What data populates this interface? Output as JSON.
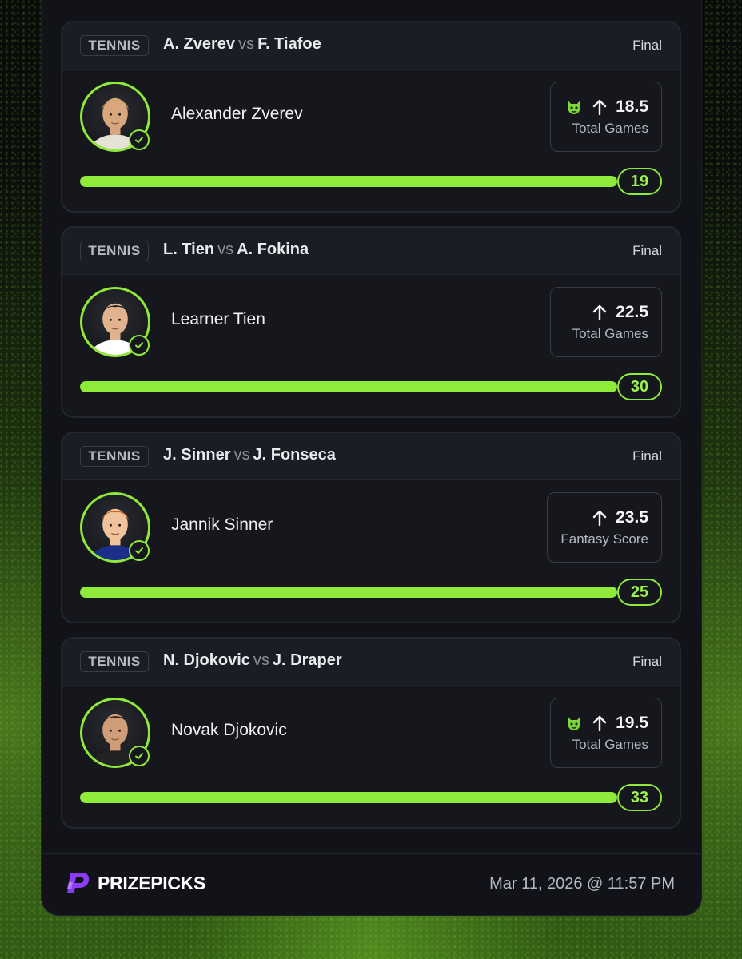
{
  "cards": [
    {
      "sport": "TENNIS",
      "player1": "A. Zverev",
      "vs": "vs",
      "player2": "F. Tiafoe",
      "status": "Final",
      "player_name": "Alexander Zverev",
      "has_demon_icon": true,
      "direction_icon": "arrow-up-icon",
      "line": "18.5",
      "stat": "Total Games",
      "result": "19",
      "progress": 1.0
    },
    {
      "sport": "TENNIS",
      "player1": "L. Tien",
      "vs": "vs",
      "player2": "A. Fokina",
      "status": "Final",
      "player_name": "Learner Tien",
      "has_demon_icon": false,
      "direction_icon": "arrow-up-icon",
      "line": "22.5",
      "stat": "Total Games",
      "result": "30",
      "progress": 1.0
    },
    {
      "sport": "TENNIS",
      "player1": "J. Sinner",
      "vs": "vs",
      "player2": "J. Fonseca",
      "status": "Final",
      "player_name": "Jannik Sinner",
      "has_demon_icon": false,
      "direction_icon": "arrow-up-icon",
      "line": "23.5",
      "stat": "Fantasy Score",
      "result": "25",
      "progress": 1.0
    },
    {
      "sport": "TENNIS",
      "player1": "N. Djokovic",
      "vs": "vs",
      "player2": "J. Draper",
      "status": "Final",
      "player_name": "Novak Djokovic",
      "has_demon_icon": true,
      "direction_icon": "arrow-up-icon",
      "line": "19.5",
      "stat": "Total Games",
      "result": "33",
      "progress": 1.0
    }
  ],
  "footer": {
    "brand": "PRIZEPICKS",
    "timestamp": "Mar 11, 2026 @ 11:57 PM"
  },
  "colors": {
    "accent": "#8fea3a",
    "panel": "#121319",
    "card": "#15171d"
  }
}
